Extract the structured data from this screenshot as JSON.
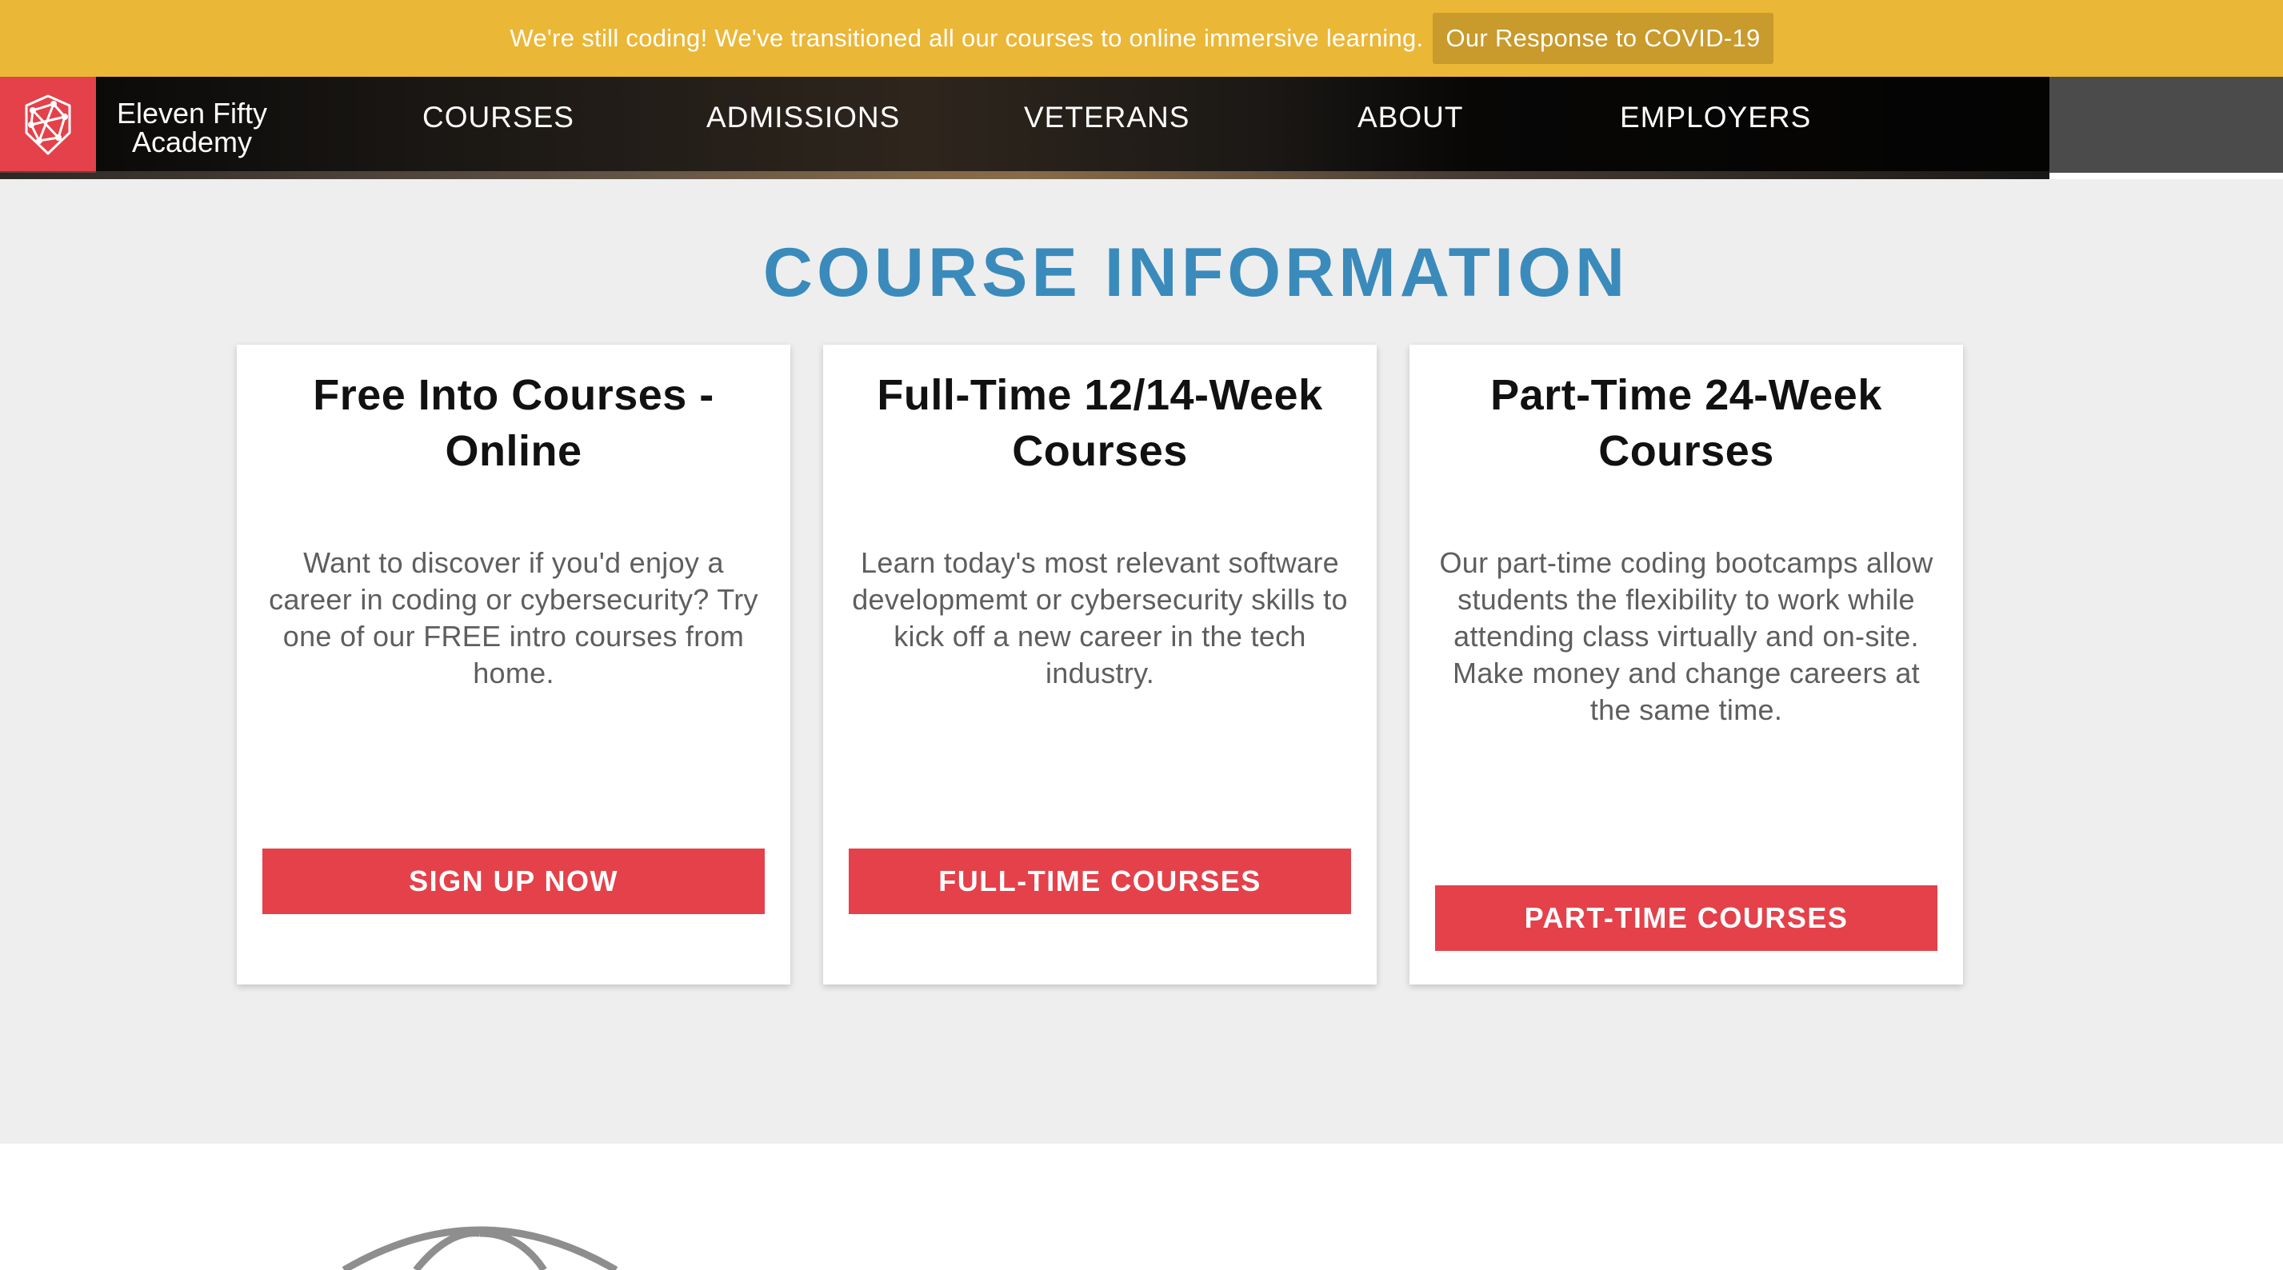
{
  "banner": {
    "text": "We're still coding! We've transitioned all our courses to online immersive learning.",
    "link_label": "Our Response to COVID-19"
  },
  "header": {
    "brand_line1": "Eleven Fifty",
    "brand_line2": "Academy",
    "logo_icon": "geometric-shield-logo",
    "nav": [
      {
        "label": "COURSES"
      },
      {
        "label": "ADMISSIONS"
      },
      {
        "label": "VETERANS"
      },
      {
        "label": "ABOUT"
      },
      {
        "label": "EMPLOYERS"
      }
    ]
  },
  "main": {
    "title": "COURSE INFORMATION",
    "cards": [
      {
        "title": "Free Into Courses - Online",
        "description": "Want to discover if you'd enjoy a career in coding or cybersecurity? Try one of our FREE intro courses from home.",
        "button": "SIGN UP NOW"
      },
      {
        "title": "Full-Time 12/14-Week Courses",
        "description": "Learn today's most relevant software developmemt or cybersecurity skills to kick off a new career in the tech industry.",
        "button": "FULL-TIME COURSES"
      },
      {
        "title": "Part-Time 24-Week Courses",
        "description": "Our part-time coding bootcamps allow students the flexibility to work while attending class virtually and on-site. Make money and change careers at the same time.",
        "button": "PART-TIME COURSES"
      }
    ]
  },
  "colors": {
    "banner": "#ebb737",
    "accent_red": "#e4414a",
    "title_blue": "#3a8bbb",
    "section_bg": "#eeeeee"
  },
  "lower": {
    "icon": "globe-icon"
  }
}
